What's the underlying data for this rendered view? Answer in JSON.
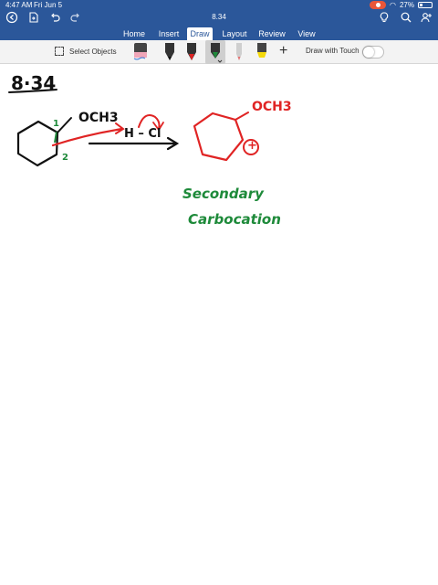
{
  "status": {
    "time": "4:47 AM",
    "date": "Fri Jun 5",
    "battery": "27%",
    "battery_level": 0.27
  },
  "document": {
    "title": "8.34"
  },
  "tabs": [
    {
      "label": "Home"
    },
    {
      "label": "Insert"
    },
    {
      "label": "Draw",
      "active": true
    },
    {
      "label": "Layout"
    },
    {
      "label": "Review"
    },
    {
      "label": "View"
    }
  ],
  "ribbon": {
    "select_objects": "Select Objects",
    "draw_with_touch": "Draw with Touch",
    "draw_with_touch_on": false
  },
  "colors": {
    "brand": "#2b579a",
    "ink_black": "#111111",
    "ink_red": "#e02424",
    "ink_green": "#1e8a3a",
    "highlighter": "#f5d90a"
  },
  "notes": {
    "problem_number": "8·34",
    "reactant_substituent": "OCH3",
    "locant_1": "1",
    "locant_2": "2",
    "reagent": "H – Cl",
    "product_substituent": "OCH3",
    "charge": "+",
    "label_line1": "Secondary",
    "label_line2": "Carbocation"
  }
}
